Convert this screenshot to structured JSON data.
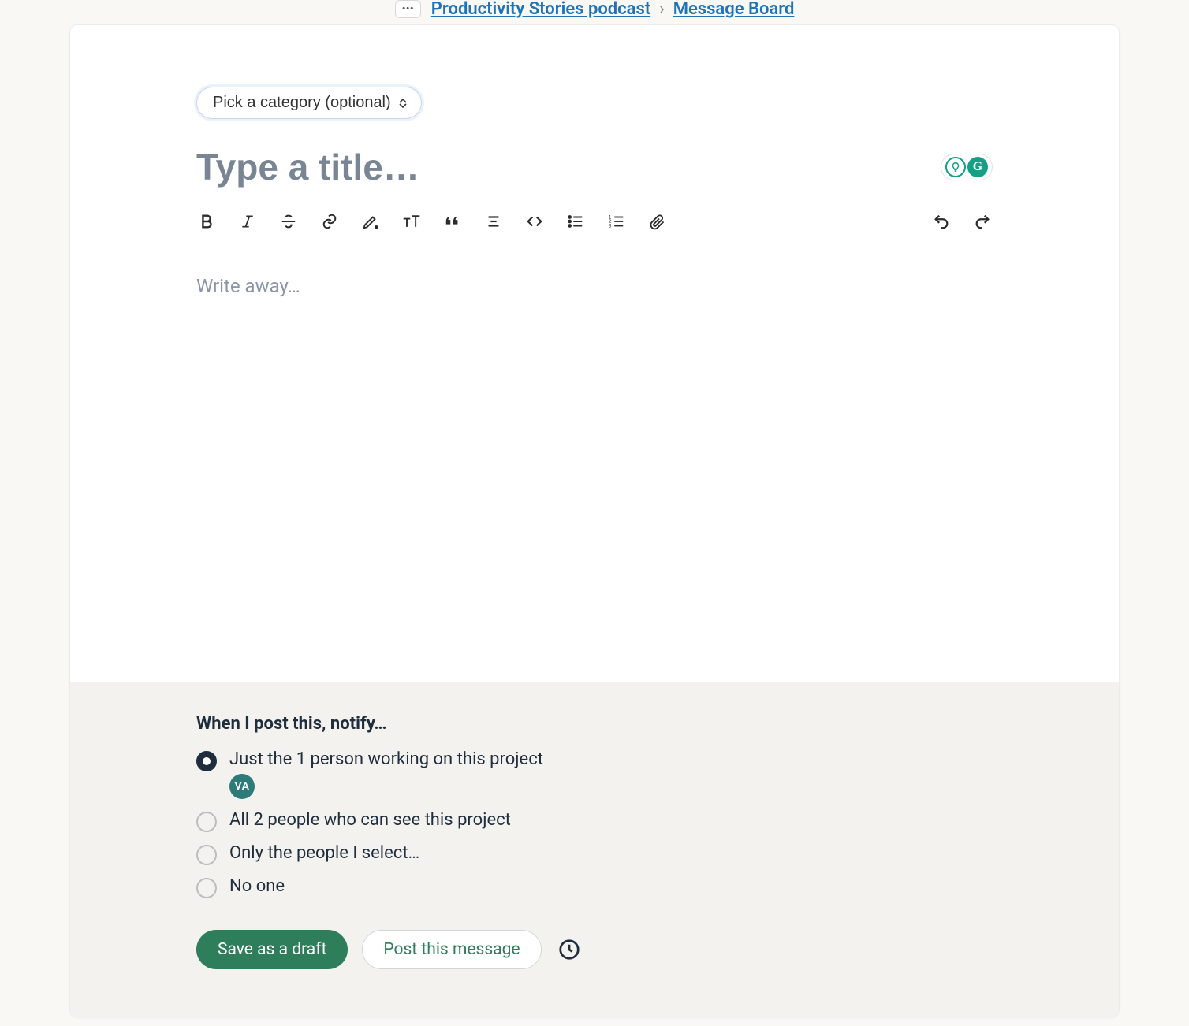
{
  "breadcrumb": {
    "project": "Productivity Stories podcast",
    "section": "Message Board",
    "chip": "•••"
  },
  "composer": {
    "category_label": "Pick a category (optional)",
    "title_placeholder": "Type a title…",
    "body_placeholder": "Write away…"
  },
  "notify": {
    "heading": "When I post this, notify…",
    "options": {
      "just_working": "Just the 1 person working on this project",
      "all_people": "All 2 people who can see this project",
      "only_select": "Only the people I select…",
      "no_one": "No one"
    },
    "avatar_initials": "VA"
  },
  "actions": {
    "save_draft": "Save as a draft",
    "post": "Post this message"
  }
}
